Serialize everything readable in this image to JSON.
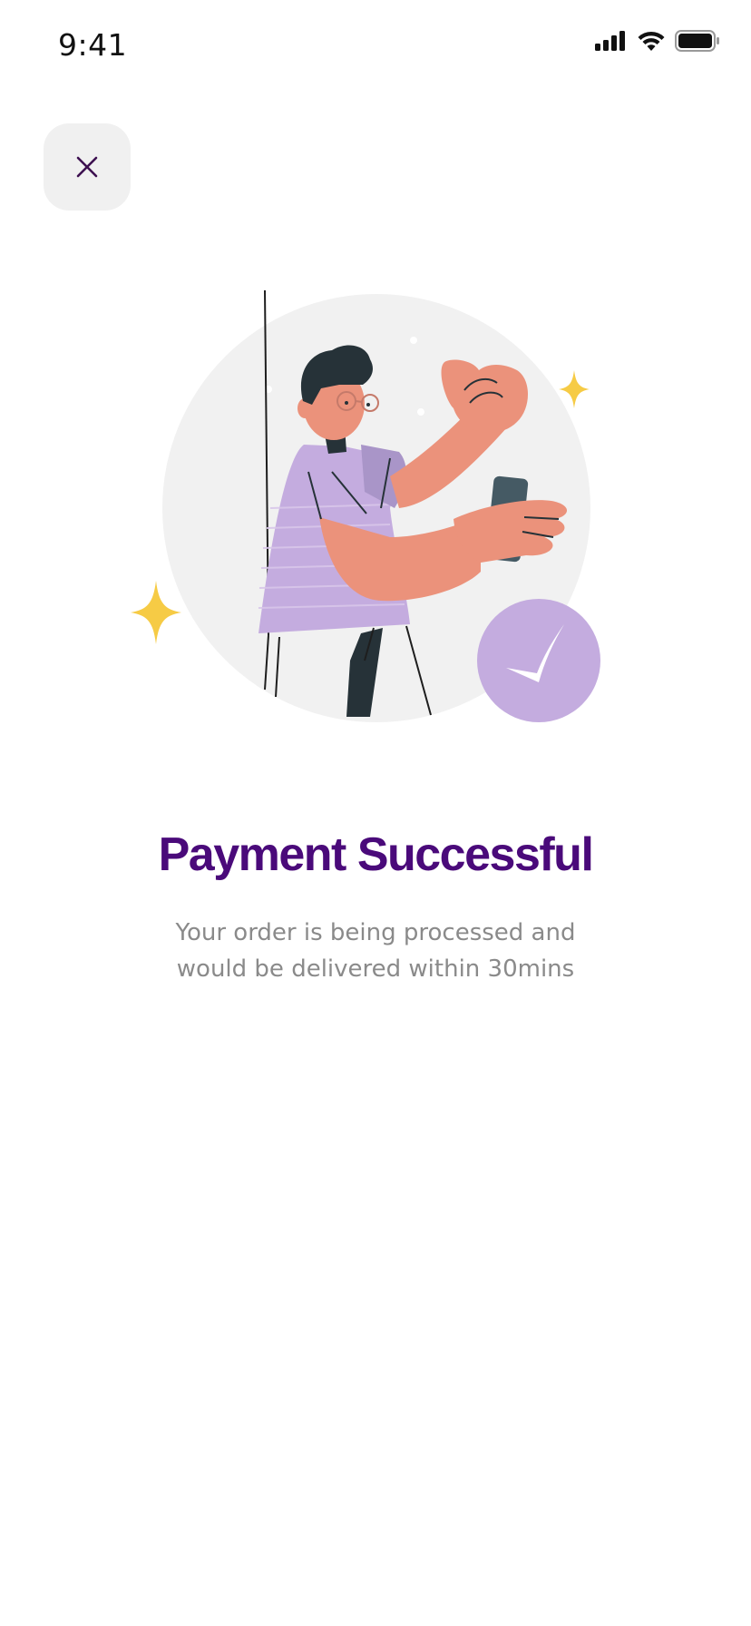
{
  "status_bar": {
    "time": "9:41"
  },
  "icons": {
    "signal": "cellular-signal-icon",
    "wifi": "wifi-icon",
    "battery": "battery-icon",
    "close": "close-icon"
  },
  "colors": {
    "title": "#4a0a7a",
    "accent_purple": "#c4acdf",
    "close_bg": "#f0f0f0",
    "sparkle_yellow": "#f6cb45"
  },
  "success": {
    "title": "Payment Successful",
    "message_line1": "Your order is being processed and",
    "message_line2": "would be delivered within 30mins"
  }
}
